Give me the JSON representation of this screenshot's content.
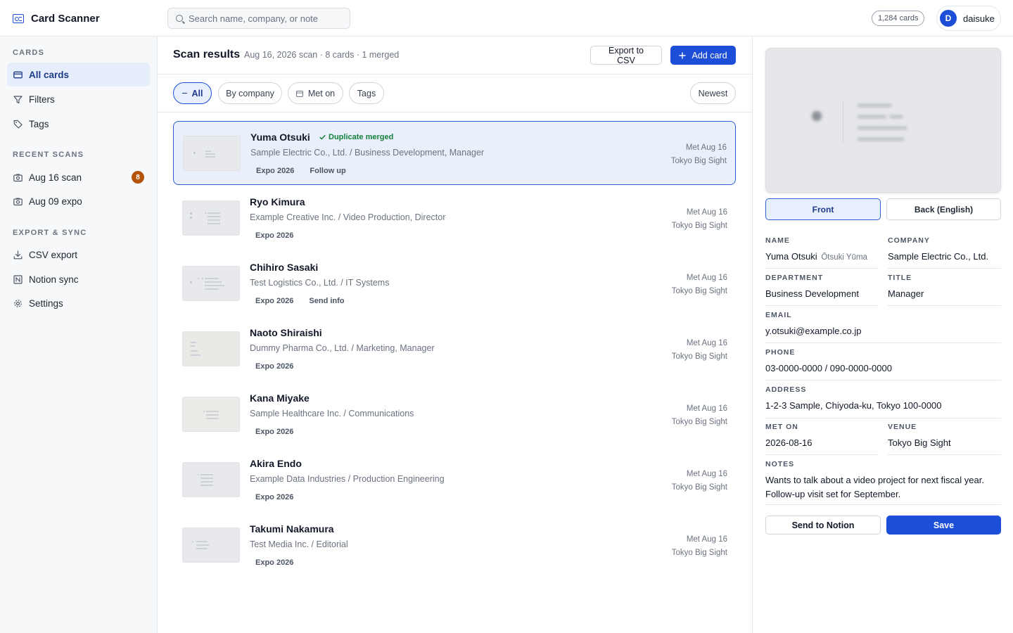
{
  "app": {
    "title": "Card Scanner",
    "search_placeholder": "Search name, company, or note",
    "card_count": "1,284 cards",
    "user": {
      "initial": "D",
      "name": "daisuke"
    },
    "accent_color": "#1d4ed8"
  },
  "sidebar": {
    "cards_heading": "CARDS",
    "cards_items": [
      {
        "label": "All cards",
        "icon": "card-icon",
        "active": true
      },
      {
        "label": "Filters",
        "icon": "filter-icon"
      },
      {
        "label": "Tags",
        "icon": "tag-icon"
      }
    ],
    "recent_heading": "RECENT SCANS",
    "recent_items": [
      {
        "label": "Aug 16 scan",
        "icon": "camera-icon",
        "badge": "8"
      },
      {
        "label": "Aug 09 expo",
        "icon": "camera-icon"
      }
    ],
    "export_heading": "EXPORT & SYNC",
    "export_items": [
      {
        "label": "CSV export",
        "icon": "download-icon"
      },
      {
        "label": "Notion sync",
        "icon": "notion-icon"
      },
      {
        "label": "Settings",
        "icon": "gear-icon"
      }
    ]
  },
  "results": {
    "title": "Scan results",
    "meta": "Aug 16, 2026 scan · 8 cards · 1 merged",
    "export_label": "Export to CSV",
    "add_label": "Add card",
    "filters": [
      "All",
      "By company",
      "Met on",
      "Tags"
    ],
    "sort_label": "Newest",
    "rows": [
      {
        "name": "Yuma Otsuki",
        "badge": "Duplicate merged",
        "sub": "Sample Electric Co., Ltd. / Business Development, Manager",
        "tags": [
          "Expo 2026",
          "Follow up"
        ],
        "met": "Met Aug 16",
        "venue": "Tokyo Big Sight",
        "selected": true
      },
      {
        "name": "Ryo Kimura",
        "sub": "Example Creative Inc. / Video Production, Director",
        "tags": [
          "Expo 2026"
        ],
        "met": "Met Aug 16",
        "venue": "Tokyo Big Sight"
      },
      {
        "name": "Chihiro Sasaki",
        "sub": "Test Logistics Co., Ltd. / IT Systems",
        "tags": [
          "Expo 2026",
          "Send info"
        ],
        "met": "Met Aug 16",
        "venue": "Tokyo Big Sight"
      },
      {
        "name": "Naoto Shiraishi",
        "sub": "Dummy Pharma Co., Ltd. / Marketing, Manager",
        "tags": [
          "Expo 2026"
        ],
        "met": "Met Aug 16",
        "venue": "Tokyo Big Sight"
      },
      {
        "name": "Kana Miyake",
        "sub": "Sample Healthcare Inc. / Communications",
        "tags": [
          "Expo 2026"
        ],
        "met": "Met Aug 16",
        "venue": "Tokyo Big Sight"
      },
      {
        "name": "Akira Endo",
        "sub": "Example Data Industries / Production Engineering",
        "tags": [
          "Expo 2026"
        ],
        "met": "Met Aug 16",
        "venue": "Tokyo Big Sight"
      },
      {
        "name": "Takumi Nakamura",
        "sub": "Test Media Inc. / Editorial",
        "tags": [
          "Expo 2026"
        ],
        "met": "Met Aug 16",
        "venue": "Tokyo Big Sight"
      }
    ]
  },
  "detail": {
    "tabs": [
      "Front",
      "Back (English)"
    ],
    "fields": {
      "name_label": "NAME",
      "name": "Yuma Otsuki",
      "name_reading": "Ōtsuki Yūma",
      "company_label": "COMPANY",
      "company": "Sample Electric Co., Ltd.",
      "department_label": "DEPARTMENT",
      "department": "Business Development",
      "title_label": "TITLE",
      "title": "Manager",
      "email_label": "EMAIL",
      "email": "y.otsuki@example.co.jp",
      "phone_label": "PHONE",
      "phone": "03-0000-0000 / 090-0000-0000",
      "address_label": "ADDRESS",
      "address": "1-2-3 Sample, Chiyoda-ku, Tokyo 100-0000",
      "met_on_label": "MET ON",
      "met_on": "2026-08-16",
      "venue_label": "VENUE",
      "venue": "Tokyo Big Sight",
      "notes_label": "NOTES",
      "notes": "Wants to talk about a video project for next fiscal year. Follow-up visit set for September."
    },
    "send_label": "Send to Notion",
    "save_label": "Save"
  }
}
